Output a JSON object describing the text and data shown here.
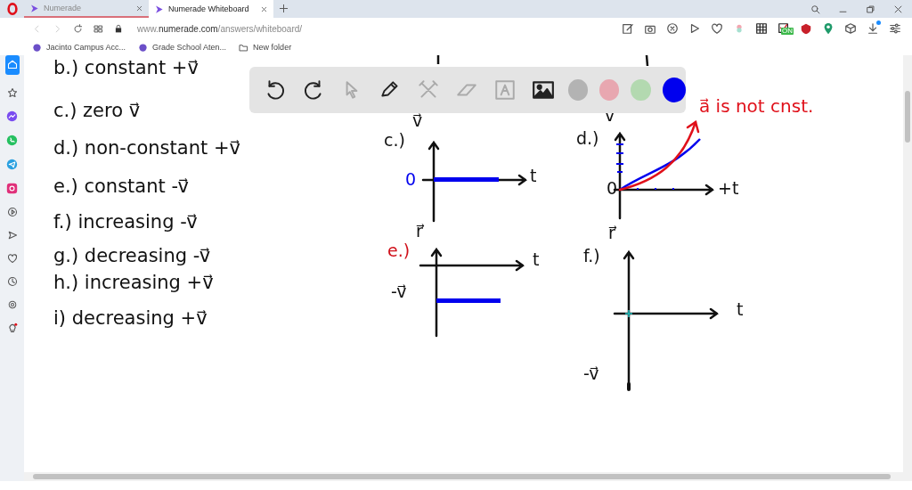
{
  "browser": {
    "tabs": [
      {
        "title": "Numerade",
        "selected": false
      },
      {
        "title": "Numerade Whiteboard",
        "selected": true
      }
    ],
    "url": "www.**numerade.com**/answers/whiteboard/",
    "extension_badge": "ON",
    "bookmarks": [
      {
        "label": "Jacinto Campus Acc...",
        "kind": "site"
      },
      {
        "label": "Grade School Aten...",
        "kind": "site"
      },
      {
        "label": "New folder",
        "kind": "folder"
      }
    ]
  },
  "whiteboard": {
    "toolbar": {
      "tools": [
        {
          "kind": "undo",
          "disabled": false
        },
        {
          "kind": "redo",
          "disabled": false
        },
        {
          "kind": "select",
          "disabled": true
        },
        {
          "kind": "pen",
          "disabled": false
        },
        {
          "kind": "tools",
          "disabled": true
        },
        {
          "kind": "eraser",
          "disabled": true
        },
        {
          "kind": "text",
          "disabled": true
        },
        {
          "kind": "image",
          "disabled": false
        }
      ],
      "colors": [
        {
          "color": "#b3b3b3",
          "selected": false
        },
        {
          "color": "#e8a7b0",
          "selected": false
        },
        {
          "color": "#b3d9b0",
          "selected": false
        },
        {
          "color": "#0000ee",
          "selected": true
        }
      ]
    },
    "notes": [
      "b.) constant +v⃗",
      "c.) zero v⃗",
      "d.) non-constant +v⃗",
      "e.) constant -v⃗",
      "f.) increasing -v⃗",
      "g.) decreasing -v⃗",
      "h.) increasing +v⃗",
      "i) decreasing +v⃗"
    ],
    "graphs": [
      {
        "label": "c.)",
        "color": "#111111",
        "y_label": "v⃗",
        "x_label": "t",
        "value_label": "0",
        "kind": "zero"
      },
      {
        "label": "d.)",
        "color": "#111111",
        "y_label": "v",
        "x_label": "+t",
        "value_label": "0",
        "kind": "curves"
      },
      {
        "label": "e.)",
        "color": "#d0101a",
        "y_label": "r⃗",
        "x_label": "t",
        "value_label": "-v⃗",
        "kind": "negative"
      },
      {
        "label": "f.)",
        "color": "#111111",
        "y_label": "r⃗",
        "x_label": "t",
        "value_label": "-v⃗",
        "kind": "empty"
      }
    ],
    "annotation": "a⃗ is not cnst."
  }
}
